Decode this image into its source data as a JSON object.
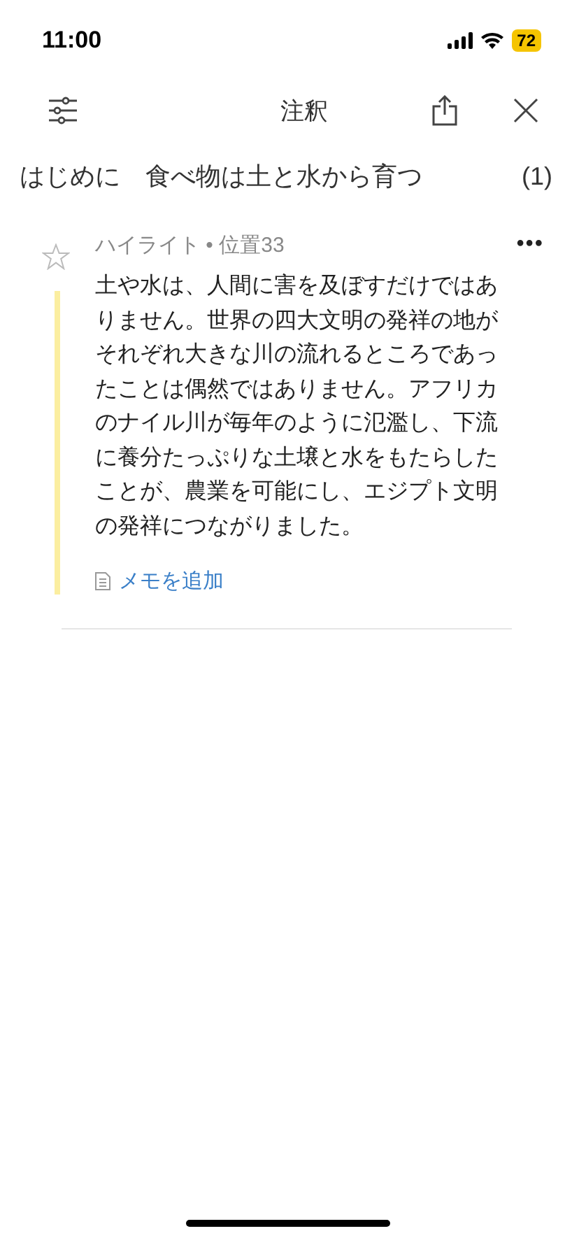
{
  "status_bar": {
    "time": "11:00",
    "battery": "72"
  },
  "toolbar": {
    "title": "注釈"
  },
  "chapter": {
    "title": "はじめに　食べ物は土と水から育つ",
    "count": "(1)"
  },
  "annotations": [
    {
      "kind": "highlight",
      "starred": false,
      "type_label": "ハイライト",
      "separator": "•",
      "location": "位置33",
      "menu": "•••",
      "text": "土や水は、人間に害を及ぼすだけではありません。世界の四大文明の発祥の地がそれぞれ大きな川の流れるところであったことは偶然ではありません。アフリカのナイル川が毎年のように氾濫し、下流に養分たっぷりな土壌と水をもたらしたことが、農業を可能にし、エジプト文明の発祥につながりました。",
      "add_note": "メモを追加"
    }
  ]
}
